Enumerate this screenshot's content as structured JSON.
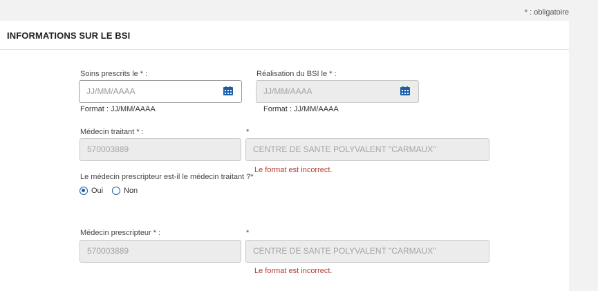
{
  "required_note": "* : obligatoire",
  "section": {
    "title": "INFORMATIONS SUR LE BSI"
  },
  "soins": {
    "label": "Soins prescrits le * :",
    "placeholder": "JJ/MM/AAAA",
    "format_hint": "Format : JJ/MM/AAAA",
    "icon": "calendar-icon"
  },
  "realisation": {
    "label": "Réalisation du BSI le * :",
    "placeholder": "JJ/MM/AAAA",
    "format_hint": "Format : JJ/MM/AAAA",
    "icon": "calendar-icon"
  },
  "medecin_traitant": {
    "label": "Médecin traitant * :",
    "id_value": "570003889",
    "name_label": "*",
    "name_value": "CENTRE DE SANTE POLYVALENT \"CARMAUX\"",
    "error": "Le format est incorrect."
  },
  "question": {
    "label": "Le médecin prescripteur est-il le médecin traitant ?*",
    "options": [
      "Oui",
      "Non"
    ],
    "selected": "Oui"
  },
  "medecin_prescripteur": {
    "label": "Médecin prescripteur * :",
    "id_value": "570003889",
    "name_label": "*",
    "name_value": "CENTRE DE SANTE POLYVALENT \"CARMAUX\"",
    "error": "Le format est incorrect."
  },
  "colors": {
    "accent": "#1a5fa8",
    "error": "#b23b2e",
    "disabled_bg": "#ececec"
  }
}
